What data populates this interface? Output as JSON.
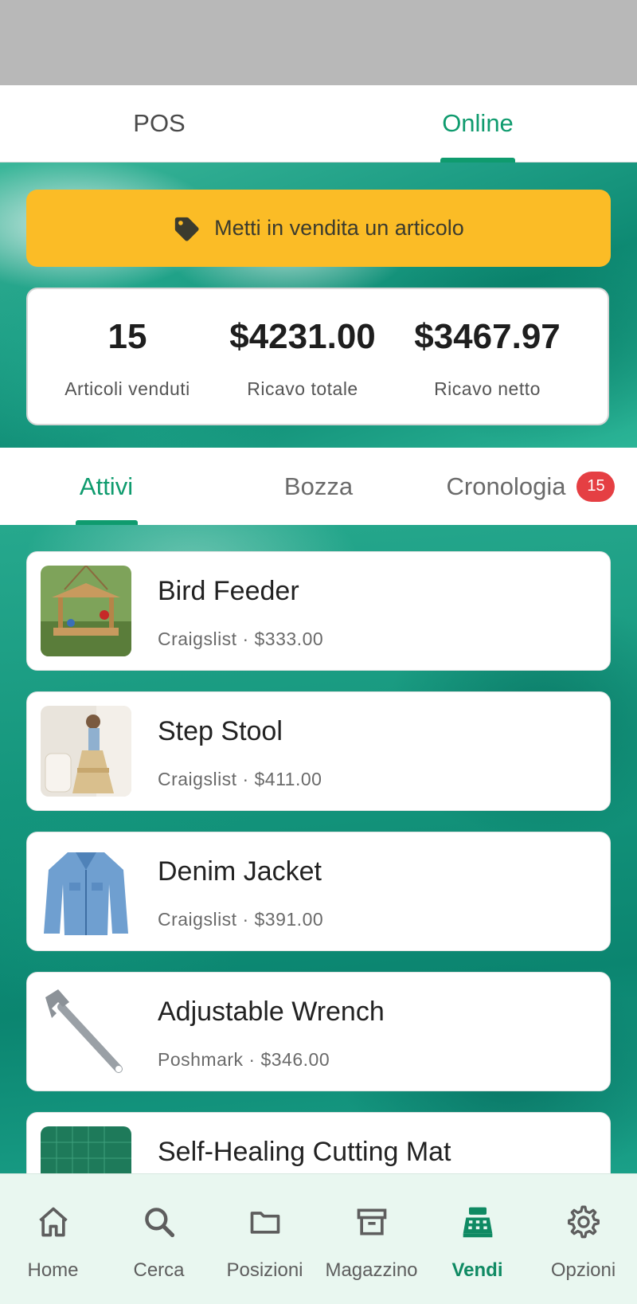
{
  "top_tabs": [
    {
      "label": "POS",
      "active": false
    },
    {
      "label": "Online",
      "active": true
    }
  ],
  "sell_button": {
    "label": "Metti in vendita un articolo",
    "icon": "tag-icon"
  },
  "stats": [
    {
      "value": "15",
      "label": "Articoli venduti"
    },
    {
      "value": "$4231.00",
      "label": "Ricavo totale"
    },
    {
      "value": "$3467.97",
      "label": "Ricavo netto"
    }
  ],
  "sub_tabs": [
    {
      "label": "Attivi",
      "active": true
    },
    {
      "label": "Bozza",
      "active": false
    },
    {
      "label": "Cronologia",
      "active": false,
      "badge": "15"
    }
  ],
  "listings": [
    {
      "title": "Bird Feeder",
      "subtitle": "Craigslist · $333.00",
      "thumb": "bird-feeder-thumbnail"
    },
    {
      "title": "Step Stool",
      "subtitle": "Craigslist · $411.00",
      "thumb": "step-stool-thumbnail"
    },
    {
      "title": "Denim Jacket",
      "subtitle": "Craigslist · $391.00",
      "thumb": "denim-jacket-thumbnail"
    },
    {
      "title": "Adjustable Wrench",
      "subtitle": "Poshmark · $346.00",
      "thumb": "wrench-thumbnail"
    },
    {
      "title": "Self-Healing Cutting Mat",
      "subtitle": "",
      "thumb": "cutting-mat-thumbnail"
    }
  ],
  "bottom_nav": [
    {
      "label": "Home",
      "icon": "home-icon",
      "active": false
    },
    {
      "label": "Cerca",
      "icon": "search-icon",
      "active": false
    },
    {
      "label": "Posizioni",
      "icon": "folder-icon",
      "active": false
    },
    {
      "label": "Magazzino",
      "icon": "archive-icon",
      "active": false
    },
    {
      "label": "Vendi",
      "icon": "cash-register-icon",
      "active": true
    },
    {
      "label": "Opzioni",
      "icon": "gear-icon",
      "active": false
    }
  ],
  "colors": {
    "accent": "#0f9b6e",
    "sell_button": "#fbbc26",
    "badge": "#e53f43",
    "nav_background": "#e9f7f0"
  }
}
